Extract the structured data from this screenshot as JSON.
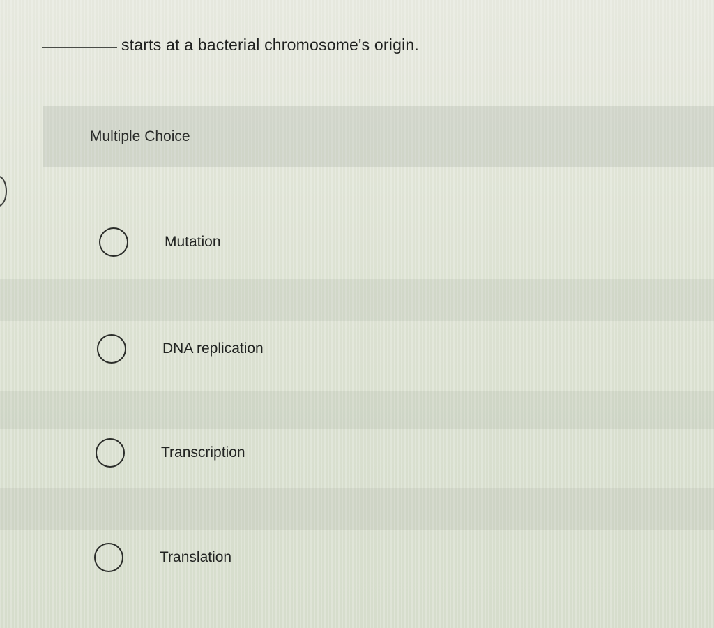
{
  "question": {
    "text": "starts at a bacterial chromosome's origin."
  },
  "multiple_choice": {
    "label": "Multiple Choice",
    "options": [
      {
        "label": "Mutation",
        "selected": false
      },
      {
        "label": "DNA replication",
        "selected": false
      },
      {
        "label": "Transcription",
        "selected": false
      },
      {
        "label": "Translation",
        "selected": false
      }
    ]
  }
}
